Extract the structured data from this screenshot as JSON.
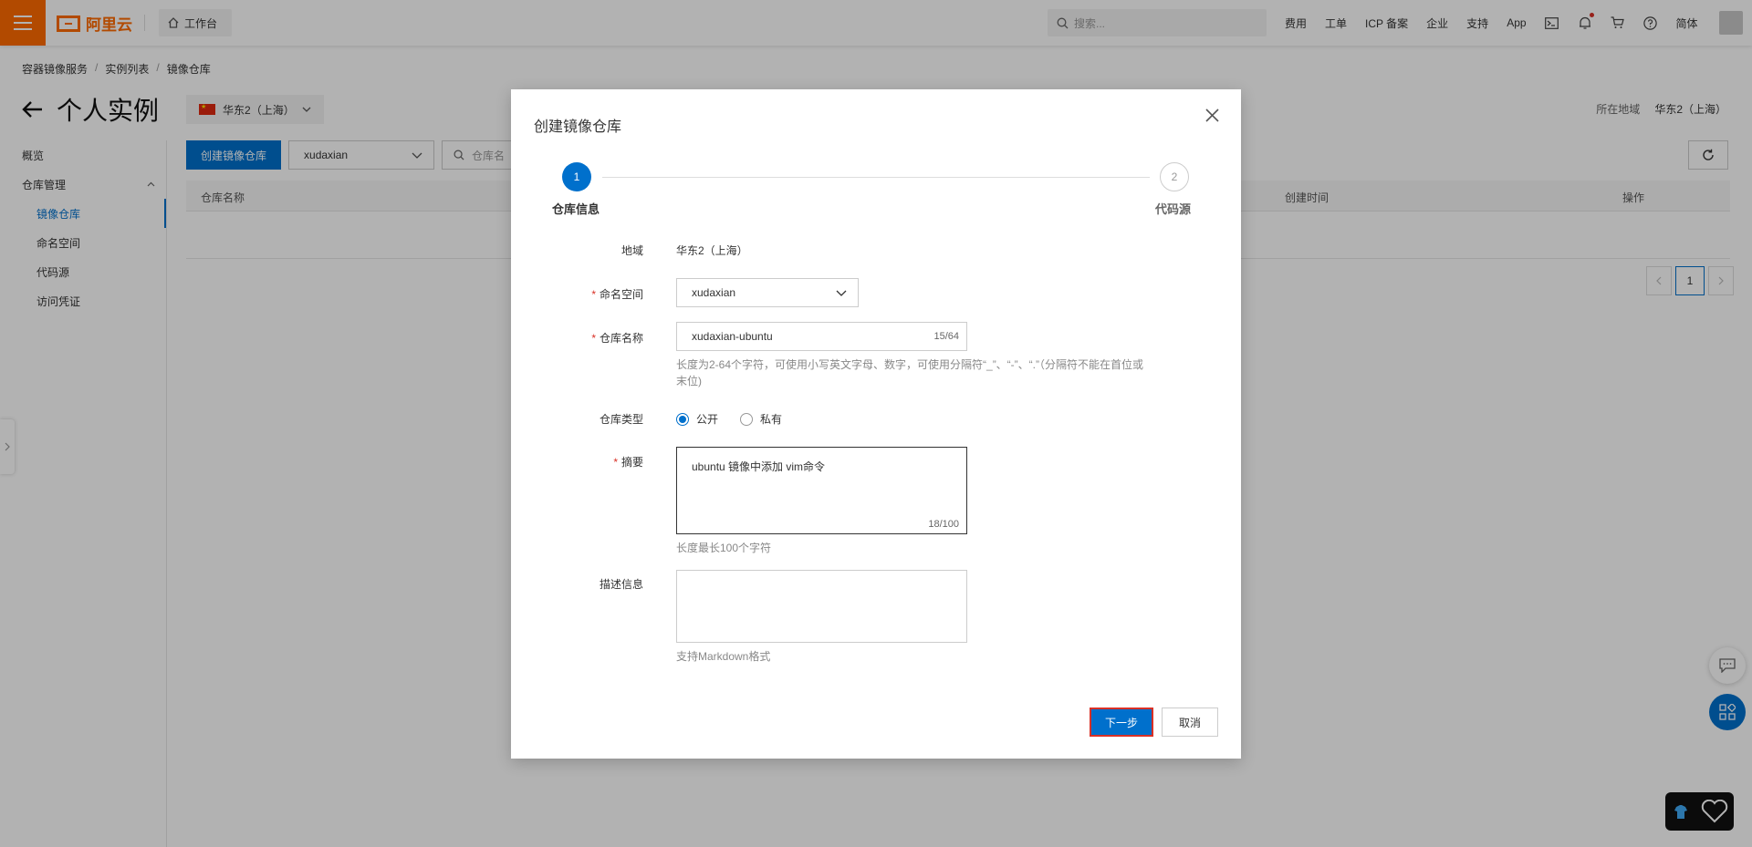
{
  "topbar": {
    "brand": "阿里云",
    "workbench": "工作台",
    "search_placeholder": "搜索...",
    "nav": [
      "费用",
      "工单",
      "ICP 备案",
      "企业",
      "支持",
      "App"
    ],
    "lang": "简体",
    "icons": [
      "terminal-icon",
      "bell-icon",
      "cart-icon",
      "help-icon"
    ],
    "accent": "#ff6a00"
  },
  "breadcrumb": [
    "容器镜像服务",
    "实例列表",
    "镜像仓库"
  ],
  "page": {
    "title": "个人实例",
    "region": "华东2（上海）",
    "region_label": "所在地域",
    "region_value": "华东2（上海）"
  },
  "sidebar": {
    "items": [
      {
        "label": "概览"
      },
      {
        "label": "仓库管理"
      },
      {
        "label": "镜像仓库"
      },
      {
        "label": "命名空间"
      },
      {
        "label": "代码源"
      },
      {
        "label": "访问凭证"
      }
    ]
  },
  "toolbar": {
    "create_label": "创建镜像仓库",
    "namespace": "xudaxian",
    "search_placeholder": "仓库名"
  },
  "table": {
    "headers": [
      "仓库名称",
      "创建时间",
      "操作"
    ]
  },
  "pager": {
    "current": "1"
  },
  "dialog": {
    "title": "创建镜像仓库",
    "steps": [
      {
        "num": "1",
        "label": "仓库信息"
      },
      {
        "num": "2",
        "label": "代码源"
      }
    ],
    "region_label": "地域",
    "region_value": "华东2（上海）",
    "namespace_label": "命名空间",
    "namespace_value": "xudaxian",
    "name_label": "仓库名称",
    "name_value": "xudaxian-ubuntu",
    "name_counter": "15/64",
    "name_help": "长度为2-64个字符，可使用小写英文字母、数字，可使用分隔符“_”、“-”、“.”（分隔符不能在首位或末位)",
    "type_label": "仓库类型",
    "type_options": [
      "公开",
      "私有"
    ],
    "type_selected": "公开",
    "summary_label": "摘要",
    "summary_value": "ubuntu 镜像中添加 vim命令",
    "summary_counter": "18/100",
    "summary_help": "长度最长100个字符",
    "desc_label": "描述信息",
    "desc_help": "支持Markdown格式",
    "next_label": "下一步",
    "cancel_label": "取消"
  },
  "colors": {
    "primary": "#0070cc",
    "brand": "#ff6a00",
    "required": "#d93026"
  }
}
